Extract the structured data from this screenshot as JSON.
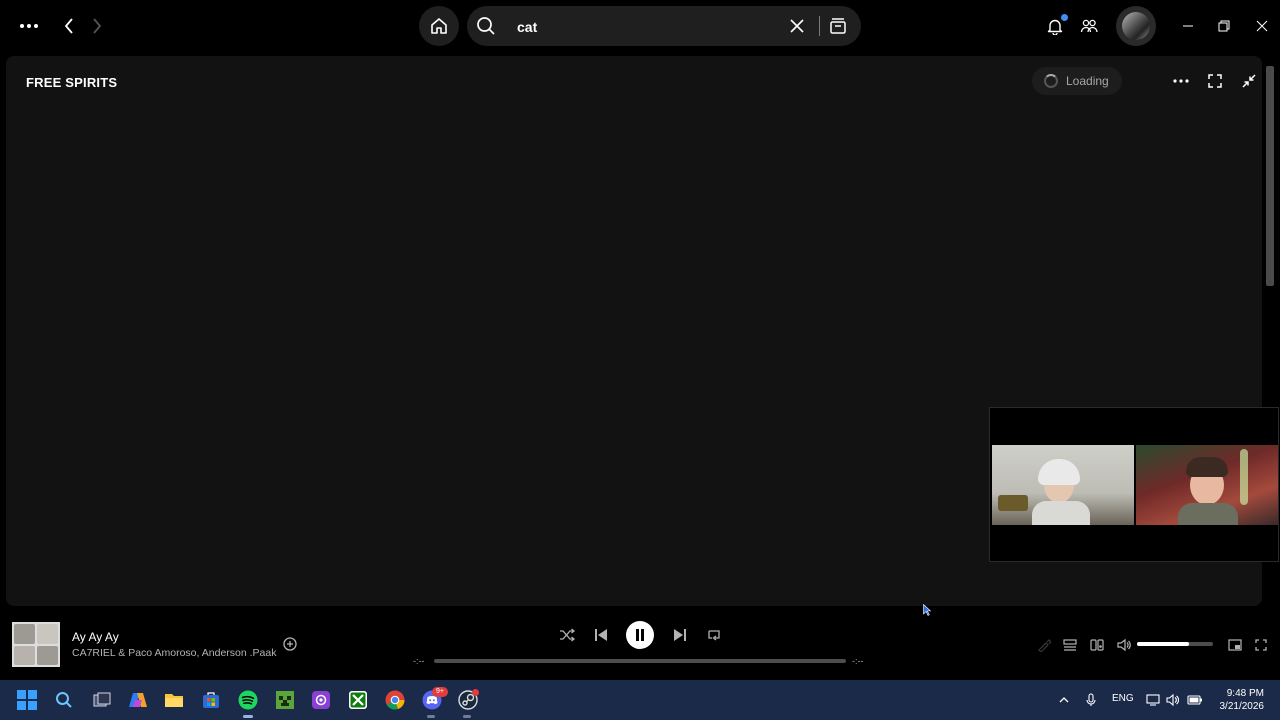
{
  "search": {
    "query": "cat"
  },
  "main": {
    "title": "FREE SPIRITS",
    "loading_label": "Loading"
  },
  "player": {
    "track_title": "Ay Ay Ay",
    "track_artist": "CA7RIEL & Paco Amoroso, Anderson .Paak",
    "elapsed": "-:--",
    "duration": "-:--",
    "progress": 0,
    "volume": 0.68,
    "state": "playing"
  },
  "taskbar": {
    "apps": [
      "start-icon",
      "search-icon",
      "task-view-icon",
      "copilot-icon",
      "file-explorer-icon",
      "microsoft-store-icon",
      "spotify-icon",
      "minecraft-icon",
      "photo-app-icon",
      "xbox-icon",
      "chrome-icon",
      "discord-icon",
      "steam-icon"
    ],
    "discord_badge": "9+",
    "language": "ENG",
    "time": "9:48 PM",
    "date": "3/21/2026"
  },
  "colors": {
    "background": "#000000",
    "panel": "#121212",
    "accent": "#1ed760",
    "taskbar": "#1c2a4a"
  }
}
